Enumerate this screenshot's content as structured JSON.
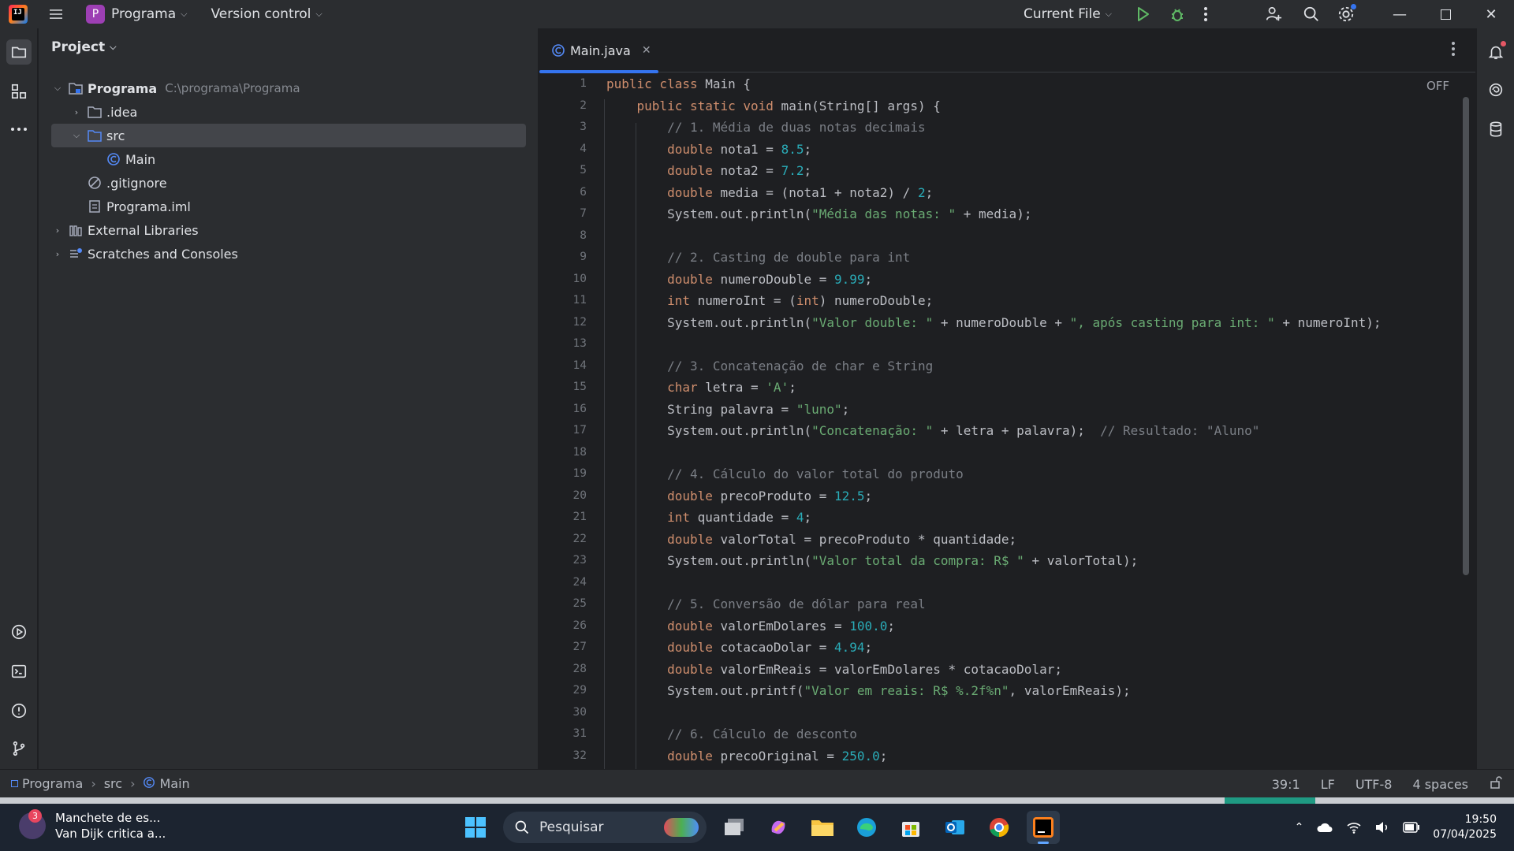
{
  "titlebar": {
    "logo_text": "IJ",
    "project_badge": "P",
    "project_name": "Programa",
    "vcs_label": "Version control",
    "run_config": "Current File"
  },
  "project_panel": {
    "title": "Project",
    "tree": [
      {
        "label": "Programa",
        "hint": "C:\\programa\\Programa"
      },
      {
        "label": ".idea"
      },
      {
        "label": "src"
      },
      {
        "label": "Main"
      },
      {
        "label": ".gitignore"
      },
      {
        "label": "Programa.iml"
      },
      {
        "label": "External Libraries"
      },
      {
        "label": "Scratches and Consoles"
      }
    ]
  },
  "editor": {
    "tab_label": "Main.java",
    "inspection_label": "OFF",
    "line_numbers": [
      "1",
      "2",
      "3",
      "4",
      "5",
      "6",
      "7",
      "8",
      "9",
      "10",
      "11",
      "12",
      "13",
      "14",
      "15",
      "16",
      "17",
      "18",
      "19",
      "20",
      "21",
      "22",
      "23",
      "24",
      "25",
      "26",
      "27",
      "28",
      "29",
      "30",
      "31",
      "32"
    ]
  },
  "statusbar": {
    "crumbs": [
      "Programa",
      "src",
      "Main"
    ],
    "position": "39:1",
    "line_ending": "LF",
    "encoding": "UTF-8",
    "indent": "4 spaces"
  },
  "taskbar": {
    "news_count": "3",
    "news_title": "Manchete de es...",
    "news_sub": "Van Dijk critica a...",
    "search_placeholder": "Pesquisar",
    "time": "19:50",
    "date": "07/04/2025"
  },
  "colors": {
    "keyword": "#cf8e6d",
    "number": "#2aacb8",
    "string": "#6aab73",
    "comment": "#7a7e85",
    "accent": "#3574f0"
  }
}
